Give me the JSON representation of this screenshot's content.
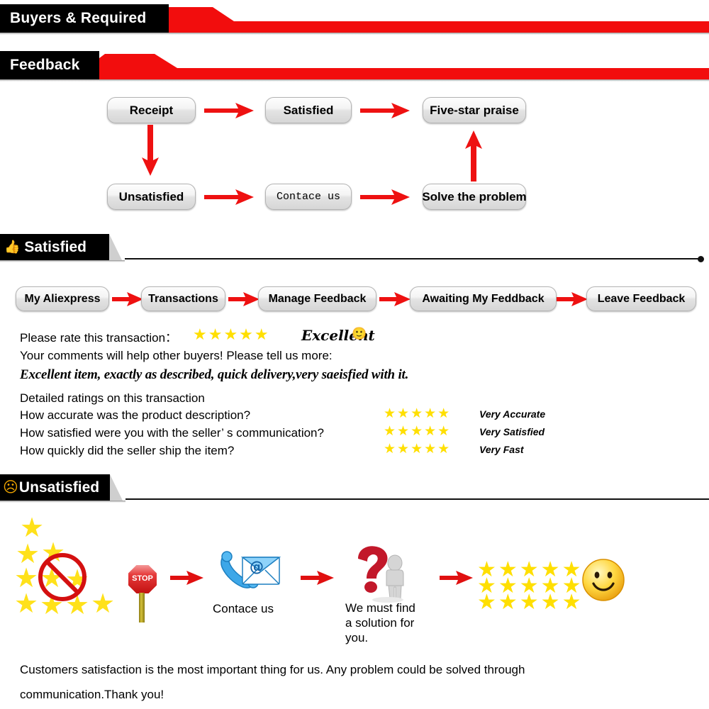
{
  "colors": {
    "red": "#ee1111",
    "banner_red": "#f20d0d",
    "black": "#000000",
    "star_yellow": "#FFDF00",
    "stop_red": "#e02020"
  },
  "banners": [
    {
      "title": "Buyers & Required",
      "icon": "none"
    },
    {
      "title": "Feedback",
      "icon": "none"
    }
  ],
  "flow_top": {
    "nodes": [
      {
        "label": "Receipt",
        "font": "sans"
      },
      {
        "label": "Satisfied",
        "font": "sans"
      },
      {
        "label": "Five-star praise",
        "font": "sans"
      },
      {
        "label": "Unsatisfied",
        "font": "sans"
      },
      {
        "label": "Contace us",
        "font": "mono"
      },
      {
        "label": "Solve the problem",
        "font": "sans"
      }
    ],
    "arrows": [
      {
        "name": "receipt-to-satisfied",
        "dir": "right"
      },
      {
        "name": "satisfied-to-five-star",
        "dir": "right"
      },
      {
        "name": "receipt-to-unsatisfied",
        "dir": "down"
      },
      {
        "name": "unsatisfied-to-contact",
        "dir": "right"
      },
      {
        "name": "contact-to-solve",
        "dir": "right"
      },
      {
        "name": "solve-to-five-star",
        "dir": "up"
      }
    ]
  },
  "satisfied_section": {
    "header": "Satisfied",
    "header_icon": "thumbs-up-icon",
    "steps": [
      "My Aliexpress",
      "Transactions",
      "Manage Feedback",
      "Awaiting My Feddback",
      "Leave Feedback"
    ],
    "rate_label": "Please rate this transaction：",
    "rate_stars": 5,
    "rate_word": "Excellent",
    "rate_emoji": "🙂",
    "comments_prompt": "Your comments will help other buyers! Please tell us more:",
    "comment_text": "Excellent item, exactly as described, quick delivery,very saeisfied with it.",
    "detailed_heading": "Detailed ratings on this transaction",
    "detailed_rows": [
      {
        "question": "How accurate was the product description?",
        "stars": 5,
        "verdict": "Very Accurate"
      },
      {
        "question": "How satisfied were you with the seller’ s communication?",
        "stars": 5,
        "verdict": "Very Satisfied"
      },
      {
        "question": "How quickly did the seller ship the item?",
        "stars": 5,
        "verdict": "Very Fast"
      }
    ]
  },
  "unsatisfied_section": {
    "header": "Unsatisfied",
    "header_icon": "frowning-face-icon",
    "steps": [
      {
        "name": "no-bad-rating",
        "icon": "stars-prohibited-icon",
        "caption": ""
      },
      {
        "name": "stop-sign",
        "icon": "stop-sign-icon",
        "caption": "STOP"
      },
      {
        "name": "contact-us",
        "icon": "phone-email-icon",
        "caption": "Contace us"
      },
      {
        "name": "find-solution",
        "icon": "question-mark-person-icon",
        "caption": "We must find\na solution for\nyou."
      },
      {
        "name": "five-star-result",
        "icon": "five-star-grid-icon",
        "caption": ""
      },
      {
        "name": "happy-result",
        "icon": "smiley-face-icon",
        "caption": ""
      }
    ],
    "stop_text": "STOP",
    "contact_caption": "Contace us",
    "solution_caption_lines": [
      "We must find",
      "a solution for",
      "you."
    ]
  },
  "footer": {
    "line1": "Customers satisfaction is the most important thing for us. Any problem could be solved through",
    "line2": "communication.Thank you!"
  }
}
